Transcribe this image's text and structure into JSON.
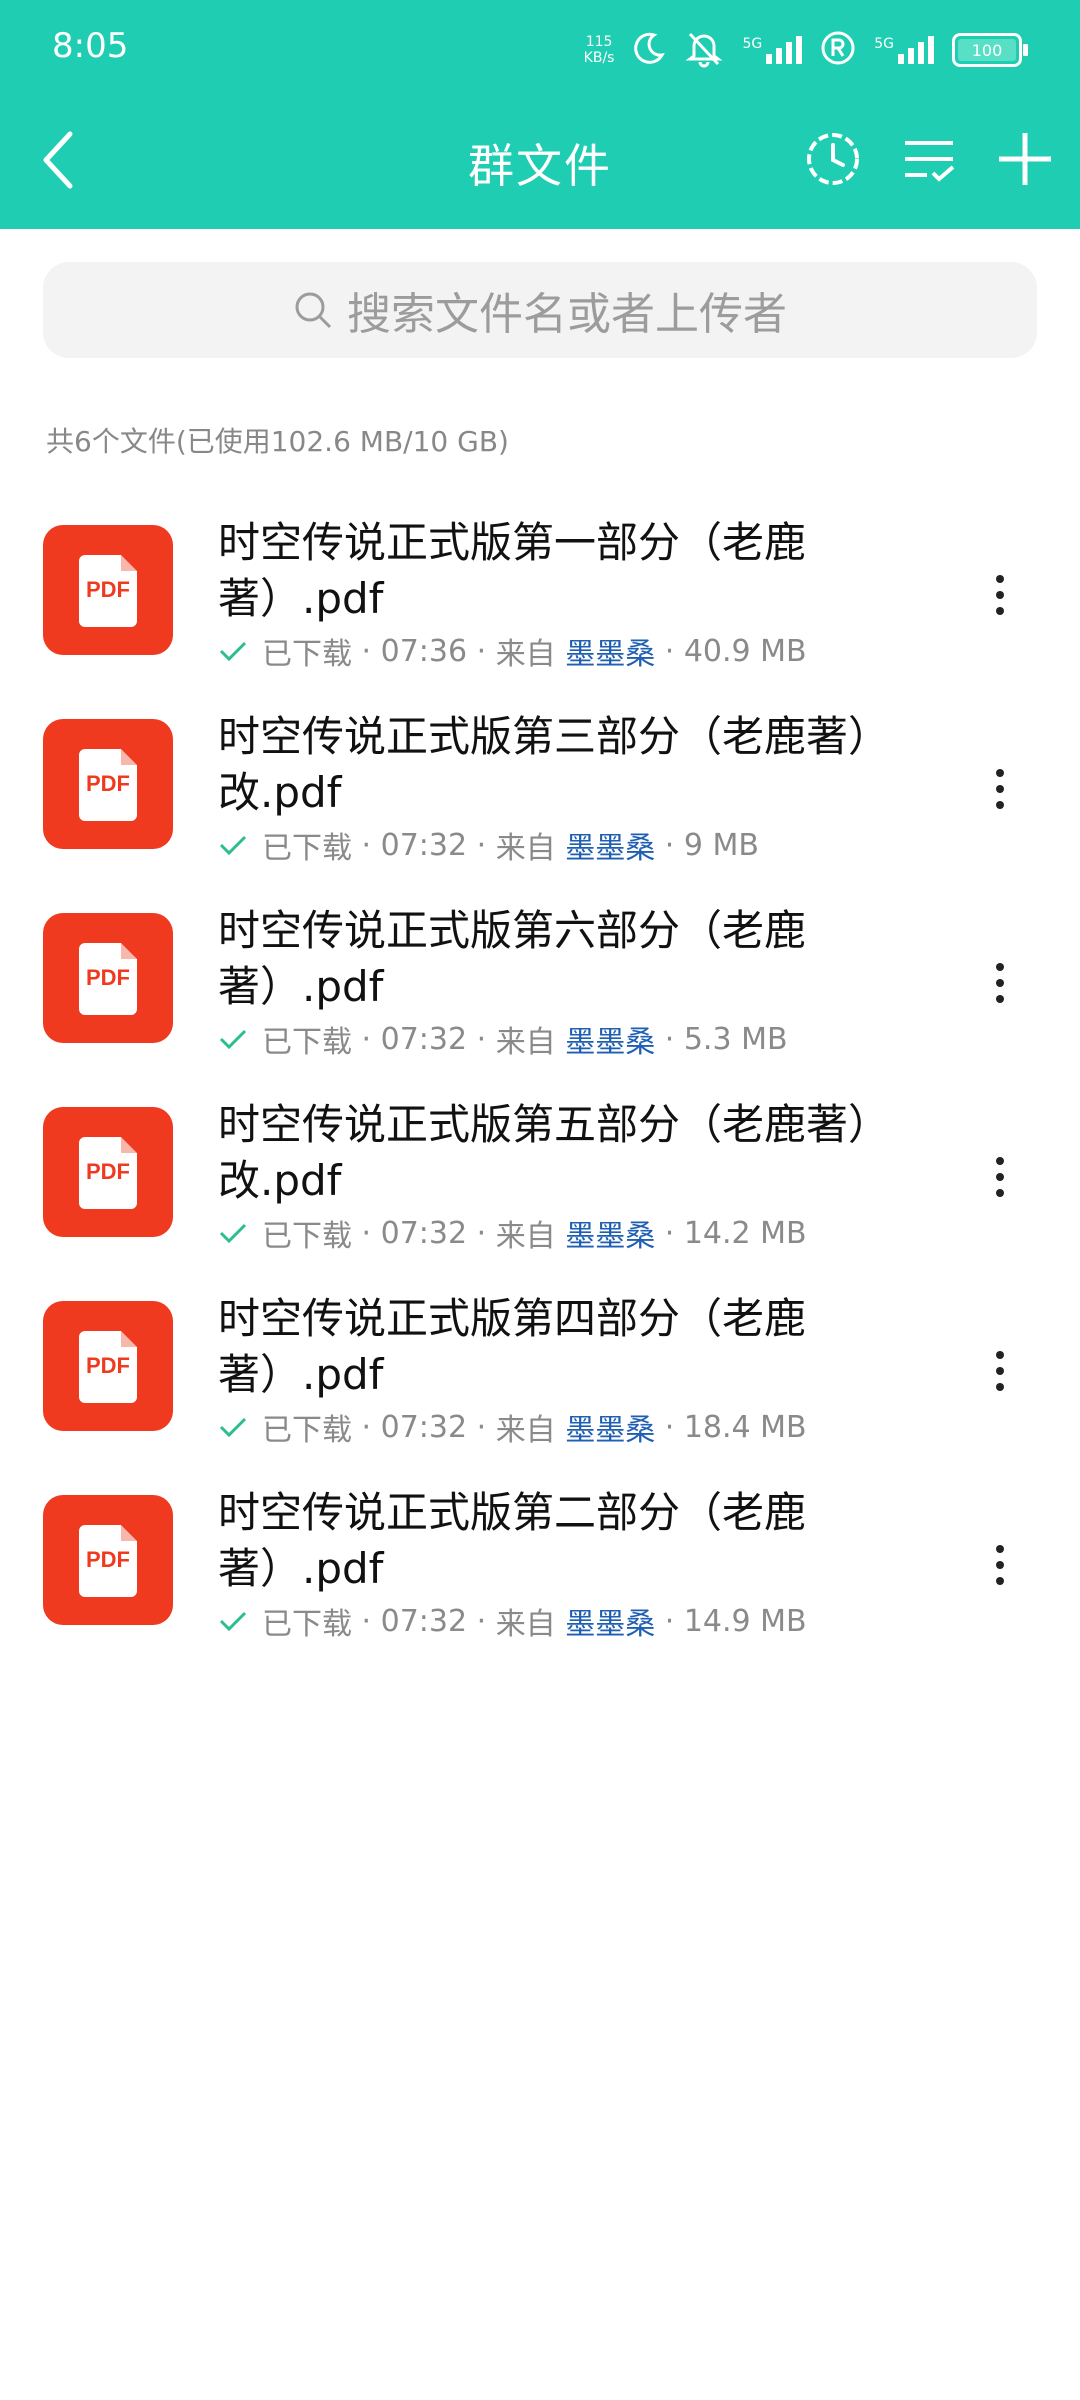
{
  "status_bar": {
    "time": "8:05",
    "net_speed_value": "115",
    "net_speed_unit": "KB/s",
    "battery": "100",
    "signal_label": "5G"
  },
  "header": {
    "title": "群文件"
  },
  "search": {
    "placeholder": "搜索文件名或者上传者"
  },
  "summary": "共6个文件(已使用102.6 MB/10 GB)",
  "colors": {
    "accent": "#1fcdb2",
    "pdf_icon": "#f03a20",
    "sender_link": "#1f5fb3",
    "check": "#2bbf8b"
  },
  "files": [
    {
      "name": "时空传说正式版第一部分（老鹿著）.pdf",
      "icon": "pdf-icon",
      "status": "已下载",
      "time": "07:36",
      "from_label": "来自",
      "sender": "墨墨桑",
      "size": "40.9 MB"
    },
    {
      "name": "时空传说正式版第三部分（老鹿著）改.pdf",
      "icon": "pdf-icon",
      "status": "已下载",
      "time": "07:32",
      "from_label": "来自",
      "sender": "墨墨桑",
      "size": "9 MB"
    },
    {
      "name": "时空传说正式版第六部分（老鹿著）.pdf",
      "icon": "pdf-icon",
      "status": "已下载",
      "time": "07:32",
      "from_label": "来自",
      "sender": "墨墨桑",
      "size": "5.3 MB"
    },
    {
      "name": "时空传说正式版第五部分（老鹿著）改.pdf",
      "icon": "pdf-icon",
      "status": "已下载",
      "time": "07:32",
      "from_label": "来自",
      "sender": "墨墨桑",
      "size": "14.2 MB"
    },
    {
      "name": "时空传说正式版第四部分（老鹿著）.pdf",
      "icon": "pdf-icon",
      "status": "已下载",
      "time": "07:32",
      "from_label": "来自",
      "sender": "墨墨桑",
      "size": "18.4 MB"
    },
    {
      "name": "时空传说正式版第二部分（老鹿著）.pdf",
      "icon": "pdf-icon",
      "status": "已下载",
      "time": "07:32",
      "from_label": "来自",
      "sender": "墨墨桑",
      "size": "14.9 MB"
    }
  ]
}
